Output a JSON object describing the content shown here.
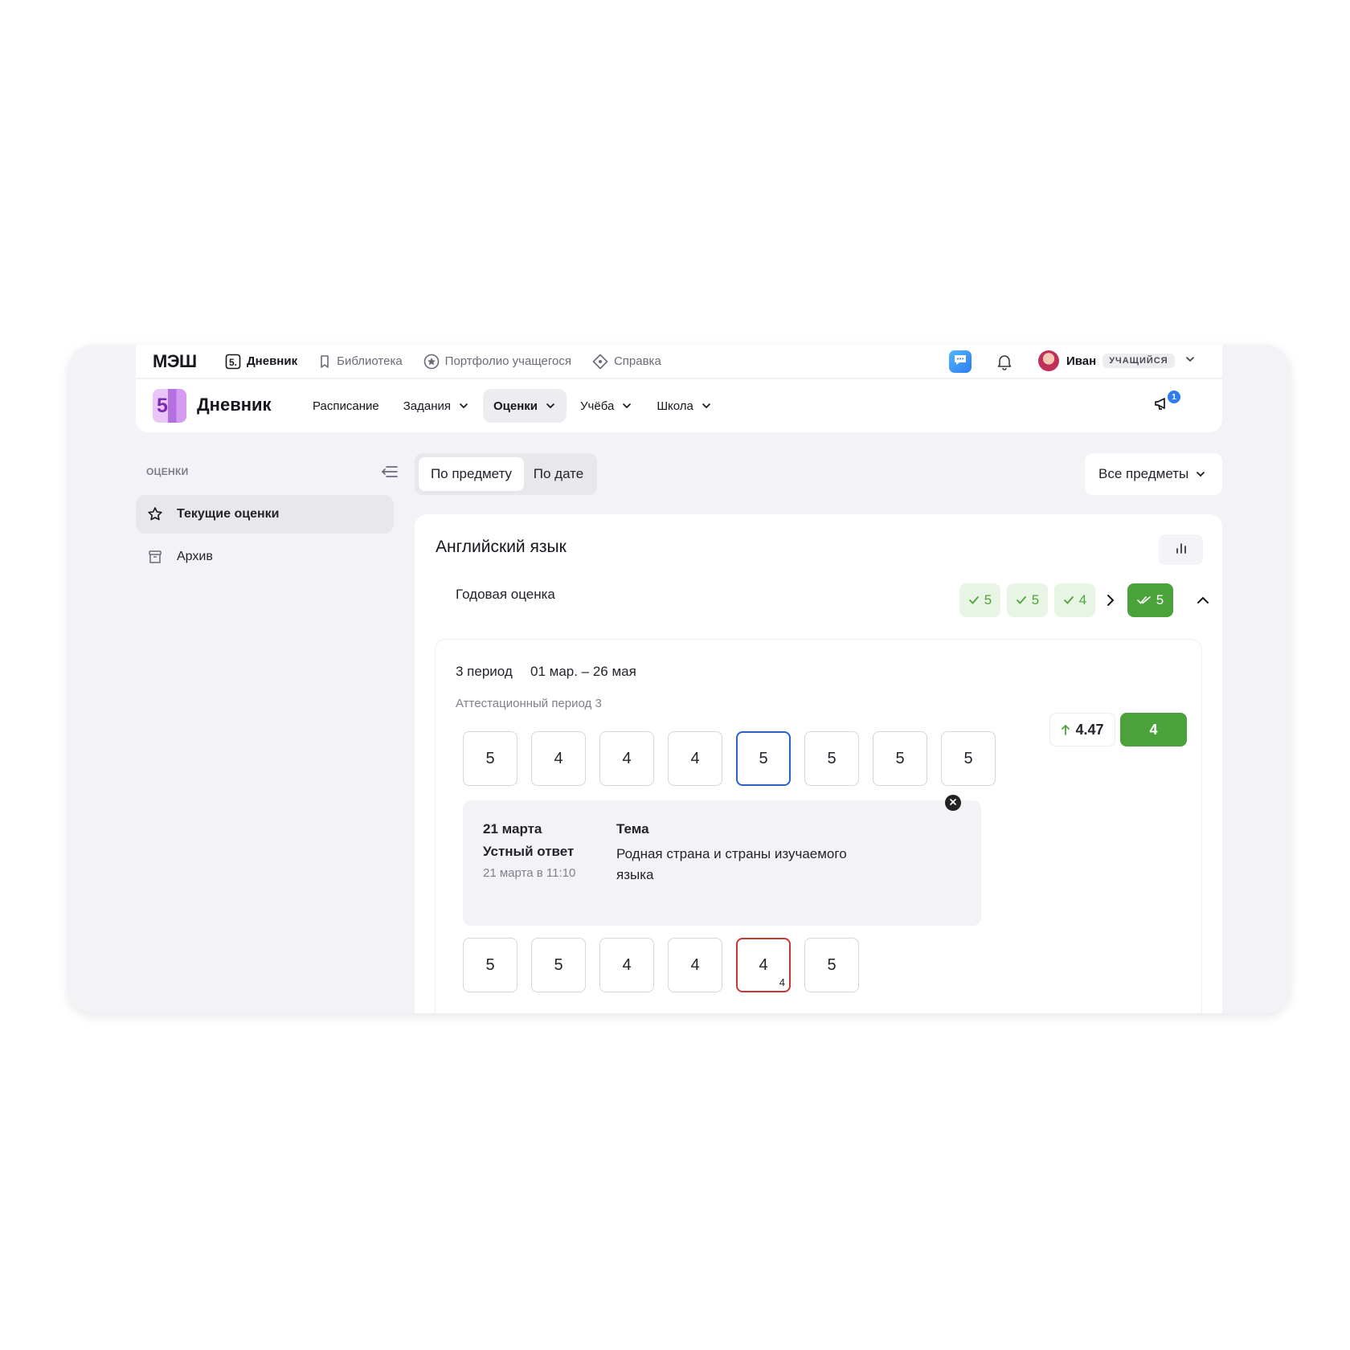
{
  "topbar": {
    "logo": "МЭШ",
    "nav": [
      {
        "label": "Дневник",
        "icon": "diary-five-icon",
        "active": true
      },
      {
        "label": "Библиотека",
        "icon": "bookmark-icon"
      },
      {
        "label": "Портфолио учащегося",
        "icon": "portfolio-star-icon"
      },
      {
        "label": "Справка",
        "icon": "help-diamond-icon"
      }
    ],
    "user": {
      "name": "Иван",
      "role": "учащийся"
    }
  },
  "subbar": {
    "logo_glyph": "5",
    "title": "Дневник",
    "nav": [
      {
        "label": "Расписание",
        "dropdown": false
      },
      {
        "label": "Задания",
        "dropdown": true
      },
      {
        "label": "Оценки",
        "dropdown": true,
        "active": true
      },
      {
        "label": "Учёба",
        "dropdown": true
      },
      {
        "label": "Школа",
        "dropdown": true
      }
    ],
    "announcements_count": "1"
  },
  "sidebar": {
    "heading": "ОЦЕНКИ",
    "items": [
      {
        "label": "Текущие оценки",
        "icon": "star-icon",
        "active": true
      },
      {
        "label": "Архив",
        "icon": "archive-icon"
      }
    ]
  },
  "view_toggle": {
    "by_subject": "По предмету",
    "by_date": "По дате",
    "selected": "По предмету"
  },
  "subject_filter": {
    "value": "Все предметы"
  },
  "subject": {
    "title": "Английский язык",
    "year": {
      "label": "Годовая оценка",
      "period_marks": [
        "5",
        "5",
        "4"
      ],
      "final_mark": "5"
    },
    "period": {
      "name": "3 период",
      "dates": "01 мар. – 26 мая",
      "subtitle": "Аттестационный период 3",
      "average": "4.47",
      "final": "4",
      "marks_row1": [
        "5",
        "4",
        "4",
        "4",
        "5",
        "5",
        "5",
        "5"
      ],
      "marks_row2": [
        "5",
        "5",
        "4",
        "4",
        "4",
        "5"
      ],
      "weighted_mark_weight": "4",
      "detail": {
        "date": "21 марта",
        "type": "Устный ответ",
        "time": "21 марта в 11:10",
        "topic_label": "Тема",
        "topic": "Родная страна и страны изучаемого языка"
      }
    }
  },
  "colors": {
    "accent_green": "#4ba23a",
    "light_green": "#e8f5e4",
    "selected_blue": "#2862c9",
    "red": "#c83636",
    "badge_blue": "#2f7bf0"
  }
}
